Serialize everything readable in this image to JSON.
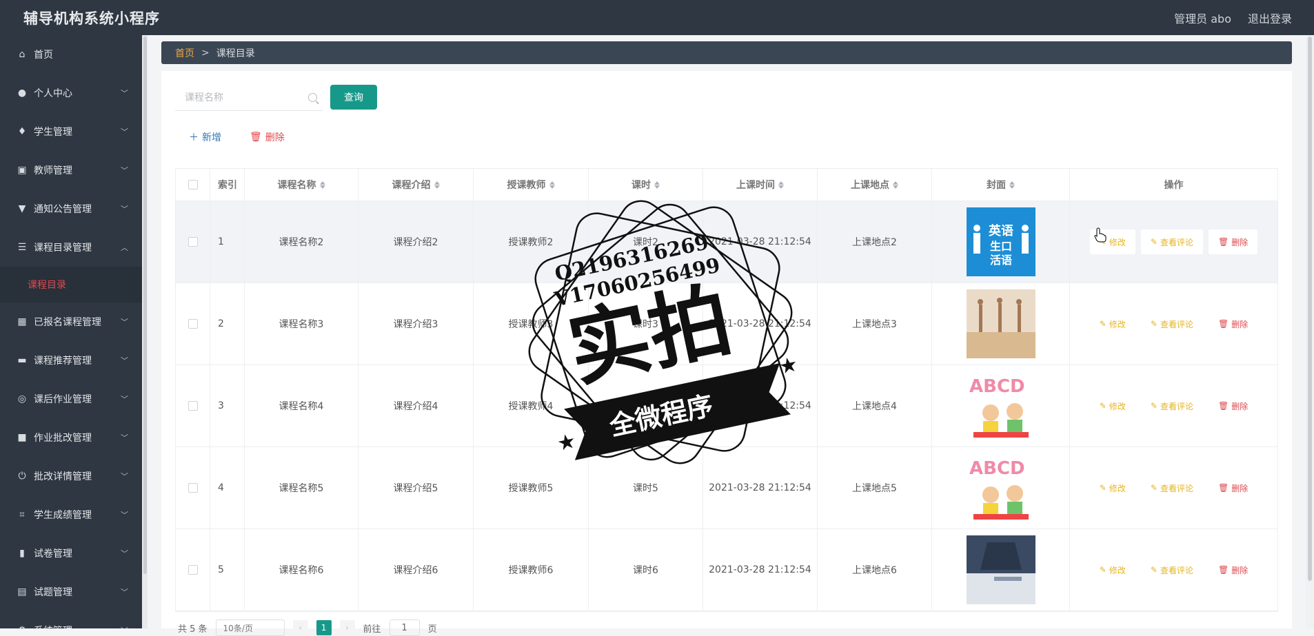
{
  "app": {
    "title": "辅导机构系统小程序",
    "admin": "管理员 abo",
    "logout": "退出登录"
  },
  "sidebar": {
    "items": [
      {
        "label": "首页",
        "icon": "home-icon",
        "glyph": "⌂",
        "has_chevron": false
      },
      {
        "label": "个人中心",
        "icon": "user-icon",
        "glyph": "●",
        "has_chevron": true
      },
      {
        "label": "学生管理",
        "icon": "microphone-icon",
        "glyph": "♦",
        "has_chevron": true
      },
      {
        "label": "教师管理",
        "icon": "clipboard-icon",
        "glyph": "▣",
        "has_chevron": true
      },
      {
        "label": "通知公告管理",
        "icon": "pen-icon",
        "glyph": "▼",
        "has_chevron": true
      },
      {
        "label": "课程目录管理",
        "icon": "list-icon",
        "glyph": "☰",
        "has_chevron": true,
        "expanded": true
      },
      {
        "label": "已报名课程管理",
        "icon": "grid-icon",
        "glyph": "▦",
        "has_chevron": true
      },
      {
        "label": "课程推荐管理",
        "icon": "monitor-icon",
        "glyph": "▬",
        "has_chevron": true
      },
      {
        "label": "课后作业管理",
        "icon": "compass-icon",
        "glyph": "◎",
        "has_chevron": true
      },
      {
        "label": "作业批改管理",
        "icon": "video-icon",
        "glyph": "■",
        "has_chevron": true
      },
      {
        "label": "批改详情管理",
        "icon": "power-icon",
        "glyph": "⏻",
        "has_chevron": true
      },
      {
        "label": "学生成绩管理",
        "icon": "crop-icon",
        "glyph": "⌗",
        "has_chevron": true
      },
      {
        "label": "试卷管理",
        "icon": "chart-icon",
        "glyph": "▮",
        "has_chevron": true
      },
      {
        "label": "试题管理",
        "icon": "card-icon",
        "glyph": "▤",
        "has_chevron": true
      },
      {
        "label": "系统管理",
        "icon": "settings-icon",
        "glyph": "⚙",
        "has_chevron": true
      }
    ],
    "active_sub": "课程目录"
  },
  "breadcrumb": {
    "home": "首页",
    "sep": ">",
    "current": "课程目录"
  },
  "search": {
    "placeholder": "课程名称",
    "query_label": "查询"
  },
  "toolbar": {
    "add_label": "新增",
    "delete_label": "删除"
  },
  "table": {
    "headers": {
      "index": "索引",
      "name": "课程名称",
      "intro": "课程介绍",
      "teacher": "授课教师",
      "hours": "课时",
      "time": "上课时间",
      "location": "上课地点",
      "cover": "封面",
      "ops": "操作"
    },
    "rows": [
      {
        "index": "1",
        "name": "课程名称2",
        "intro": "课程介绍2",
        "teacher": "授课教师2",
        "hours": "课时2",
        "time": "2021-03-28 21:12:54",
        "location": "上课地点2",
        "cover": "english-speaking"
      },
      {
        "index": "2",
        "name": "课程名称3",
        "intro": "课程介绍3",
        "teacher": "授课教师3",
        "hours": "课时3",
        "time": "2021-03-28 21:12:54",
        "location": "上课地点3",
        "cover": "dance"
      },
      {
        "index": "3",
        "name": "课程名称4",
        "intro": "课程介绍4",
        "teacher": "授课教师4",
        "hours": "课时4",
        "time": "2021-03-28 21:12:54",
        "location": "上课地点4",
        "cover": "abcd"
      },
      {
        "index": "4",
        "name": "课程名称5",
        "intro": "课程介绍5",
        "teacher": "授课教师5",
        "hours": "课时5",
        "time": "2021-03-28 21:12:54",
        "location": "上课地点5",
        "cover": "abcd"
      },
      {
        "index": "5",
        "name": "课程名称6",
        "intro": "课程介绍6",
        "teacher": "授课教师6",
        "hours": "课时6",
        "time": "2021-03-28 21:12:54",
        "location": "上课地点6",
        "cover": "study"
      }
    ],
    "ops": {
      "edit": "修改",
      "review": "查看评论",
      "remove": "删除"
    }
  },
  "cover_texts": {
    "english_1": "英语",
    "english_2": "生口",
    "english_3": "活语",
    "abcd": "ABCD"
  },
  "pagination": {
    "total": "共 5 条",
    "page_size": "10条/页",
    "current_page": "1",
    "goto": "前往",
    "goto_value": "1",
    "page_unit": "页"
  },
  "stamp": {
    "line1": "Q2196316269",
    "line2": "V17060256499",
    "big": "实拍",
    "banner": "全微程序"
  },
  "colors": {
    "sidebar": "#2e3742",
    "accent": "#17998a",
    "danger": "#e0484d",
    "warning": "#e6b422",
    "link": "#2d77b8",
    "breadcrumb_home": "#f0a640"
  }
}
